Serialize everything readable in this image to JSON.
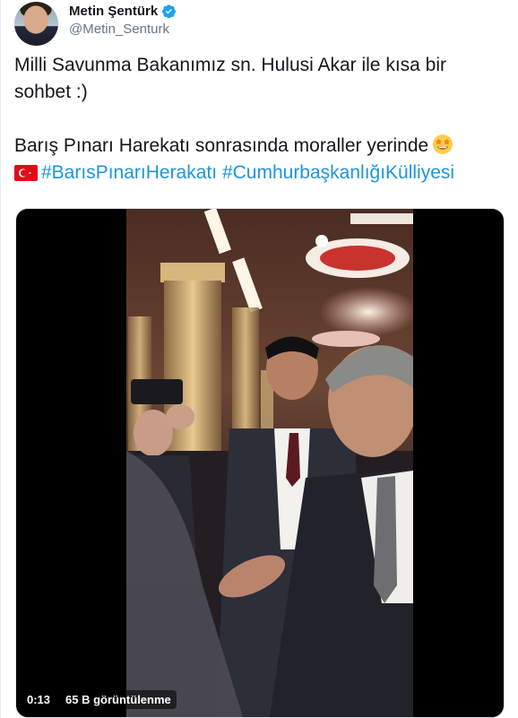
{
  "author": {
    "name": "Metin Şentürk",
    "handle": "@Metin_Senturk",
    "verified": true
  },
  "tweet": {
    "line1": "Milli Savunma Bakanımız sn. Hulusi Akar ile kısa bir sohbet :)",
    "line2": "Barış Pınarı Harekatı sonrasında moraller yerinde",
    "hashtags": [
      "#BarısPınarıHerakatı",
      "#CumhurbaşkanlığıKülliyesi"
    ],
    "emoji": "star-struck-emoji",
    "flag": "turkey-flag"
  },
  "video": {
    "duration": "0:13",
    "views": "65 B görüntülenme"
  },
  "colors": {
    "link": "#1b95e0",
    "verified": "#1da1f2",
    "text": "#14171a",
    "secondary": "#657786"
  }
}
